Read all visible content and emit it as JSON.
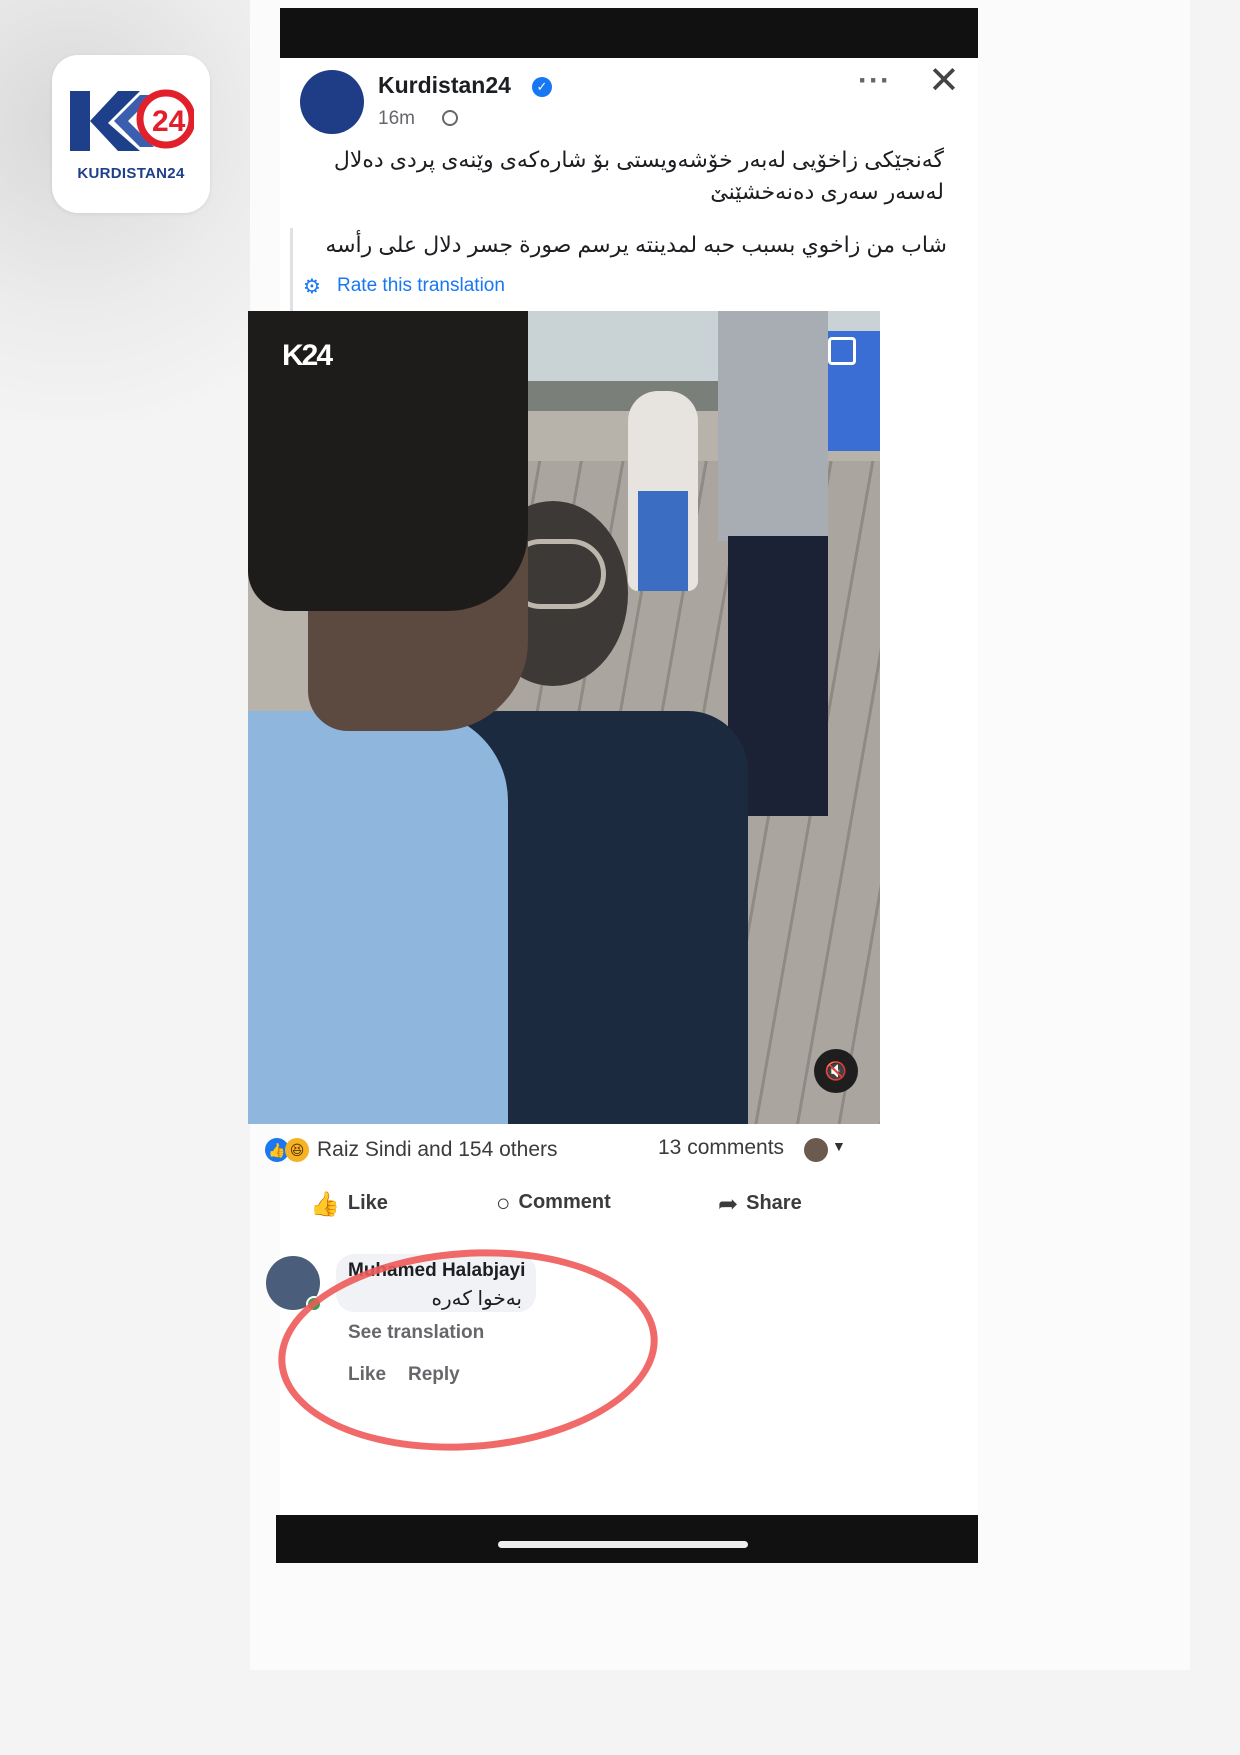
{
  "brand": {
    "logo_text": "K24",
    "wordmark": "KURDISTAN24",
    "color_blue": "#1e3f8a",
    "color_red": "#e1202b"
  },
  "post": {
    "page_name": "Kurdistan24",
    "time": "16m",
    "caption_kurdish": "گەنجێکی زاخۆیی لەبەر خۆشەویستی بۆ شارەکەی وێنەی پردی دەلال لەسەر سەری دەنەخشێنێ",
    "caption_arabic": "شاب من زاخوي بسبب حبه لمدينته يرسم صورة جسر دلال على رأسه",
    "rate_translation": "Rate this translation",
    "video_logo": "K24",
    "reactions_text": "Raiz Sindi and 154 others",
    "comments_count": "13 comments",
    "actions": {
      "like": "Like",
      "comment": "Comment",
      "share": "Share"
    },
    "icons": [
      "verified-icon",
      "globe-icon",
      "more-icon",
      "close-icon",
      "gear-icon",
      "pip-icon",
      "mute-icon",
      "like-icon",
      "comment-icon",
      "share-icon"
    ]
  },
  "comment": {
    "author": "Muhamed Halabjayi",
    "text": "بەخوا کەرە",
    "see_translation": "See translation",
    "like": "Like",
    "reply": "Reply"
  },
  "colors": {
    "facebook_blue": "#1877f2",
    "highlight_red": "#ee5a5a"
  }
}
